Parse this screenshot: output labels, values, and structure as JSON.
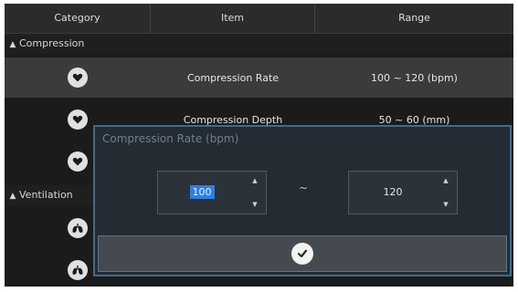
{
  "header": {
    "category": "Category",
    "item": "Item",
    "range": "Range"
  },
  "groups": [
    {
      "label": "Compression"
    },
    {
      "label": "Ventilation"
    }
  ],
  "rows": [
    {
      "item": "Compression Rate",
      "range": "100 ~ 120 (bpm)",
      "icon": "heart-icon",
      "selected": true
    },
    {
      "item": "Compression Depth",
      "range": "50 ~ 60 (mm)",
      "icon": "heart-icon"
    },
    {
      "item": "",
      "range": "",
      "icon": "heart-icon"
    },
    {
      "item": "",
      "range": "",
      "icon": "lungs-icon"
    },
    {
      "item": "",
      "range": "",
      "icon": "lungs-icon"
    }
  ],
  "dialog": {
    "title": "Compression Rate (bpm)",
    "min_value": "100",
    "max_value": "120",
    "separator": "~"
  },
  "colors": {
    "background": "#1b1b1b",
    "header": "#2b2b2b",
    "selected_row": "#3b3b3b",
    "dialog_border": "#3d6c93",
    "text_selection": "#2f7fe0"
  }
}
